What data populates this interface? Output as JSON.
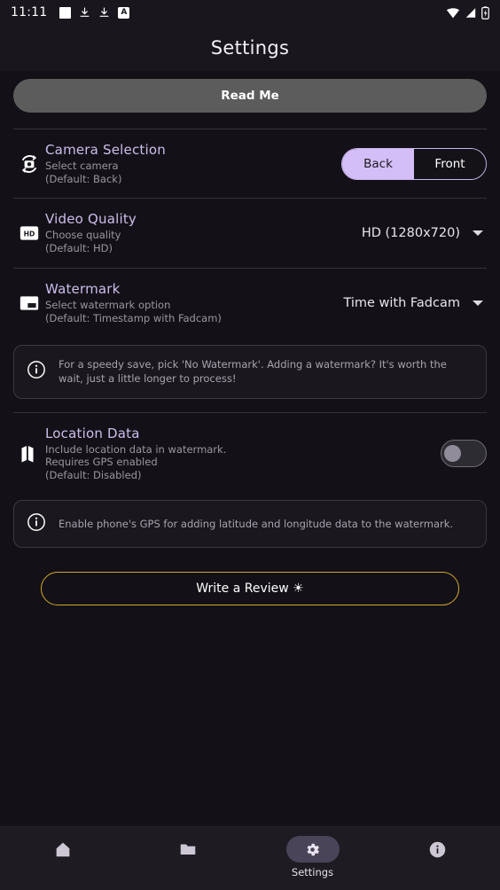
{
  "statusbar": {
    "time": "11:11",
    "left_icons": [
      "white-square-icon",
      "download-icon",
      "download-icon",
      "letter-a-icon"
    ],
    "right_icons": [
      "wifi-icon",
      "cell-signal-icon",
      "battery-charging-icon"
    ]
  },
  "header": {
    "title": "Settings"
  },
  "readme": {
    "label": "Read Me"
  },
  "settings": {
    "camera": {
      "icon": "camera-flip-icon",
      "title": "Camera Selection",
      "subtitle_1": "Select camera",
      "subtitle_2": "(Default: Back)",
      "options": [
        "Back",
        "Front"
      ],
      "selected": "Back"
    },
    "quality": {
      "icon": "hd-badge-icon",
      "title": "Video Quality",
      "subtitle_1": "Choose quality",
      "subtitle_2": "(Default: HD)",
      "value": "HD (1280x720)"
    },
    "watermark": {
      "icon": "watermark-icon",
      "title": "Watermark",
      "subtitle_1": "Select watermark option",
      "subtitle_2": "(Default: Timestamp with Fadcam)",
      "value": "Time with Fadcam"
    },
    "watermark_note": "For a speedy save, pick 'No Watermark'. Adding a watermark? It's worth the wait, just a little longer to process!",
    "location": {
      "icon": "map-icon",
      "title": "Location Data",
      "subtitle_1": "Include location data in watermark.",
      "subtitle_2": "Requires GPS enabled",
      "subtitle_3": "(Default: Disabled)",
      "enabled": false
    },
    "location_note": "Enable phone's GPS for adding latitude and longitude data to the watermark."
  },
  "review": {
    "label": "Write a Review ☀"
  },
  "bottomnav": {
    "items": [
      {
        "icon": "home-icon",
        "label": "",
        "active": false
      },
      {
        "icon": "folder-icon",
        "label": "",
        "active": false
      },
      {
        "icon": "gear-icon",
        "label": "Settings",
        "active": true
      },
      {
        "icon": "info-icon",
        "label": "",
        "active": false
      }
    ]
  },
  "colors": {
    "background": "#131117",
    "accent_purple": "#cdbdec",
    "segment_selected": "#d4bef8",
    "review_border": "#d4a72c",
    "nav_active_pill": "#4a4458"
  }
}
